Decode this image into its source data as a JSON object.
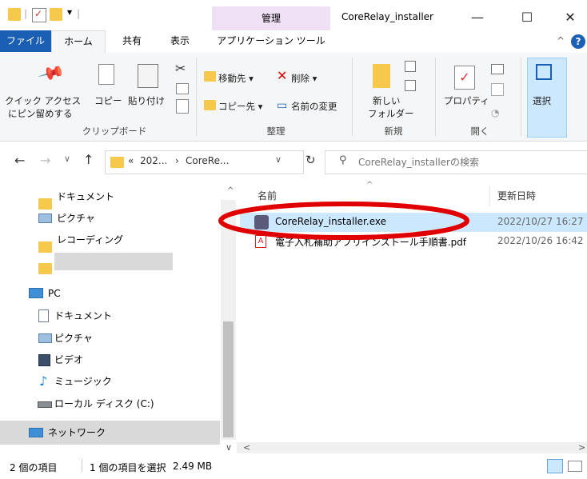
{
  "window": {
    "title": "CoreRelay_installer",
    "context_tab_group": "管理",
    "minimize": "—",
    "maximize": "☐",
    "close": "✕"
  },
  "ribbon_tabs": [
    "ファイル",
    "ホーム",
    "共有",
    "表示",
    "アプリケーション ツール"
  ],
  "ribbon": {
    "clipboard": {
      "pin_label_1": "クイック アクセス",
      "pin_label_2": "にピン留めする",
      "copy": "コピー",
      "paste": "貼り付け",
      "group": "クリップボード"
    },
    "organize": {
      "move_to": "移動先 ▾",
      "delete": "削除 ▾",
      "copy_to": "コピー先 ▾",
      "rename": "名前の変更",
      "group": "整理"
    },
    "new": {
      "new_folder_1": "新しい",
      "new_folder_2": "フォルダー",
      "group": "新規"
    },
    "open": {
      "properties": "プロパティ",
      "group": "開く"
    },
    "select": {
      "select": "選択"
    }
  },
  "address": {
    "breadcrumb_prefix": "«",
    "crumb1": "202...",
    "sep": "›",
    "crumb2": "CoreRe...",
    "search_placeholder": "CoreRelay_installerの検索"
  },
  "nav": {
    "items": [
      {
        "label": "ドキュメント",
        "icon": "folder-icon"
      },
      {
        "label": "ピクチャ",
        "icon": "pictures-icon"
      },
      {
        "label": "レコーディング",
        "icon": "folder-icon"
      },
      {
        "label": "",
        "icon": "folder-icon"
      },
      {
        "label": "PC",
        "icon": "pc-icon"
      },
      {
        "label": "ドキュメント",
        "icon": "documents-icon"
      },
      {
        "label": "ピクチャ",
        "icon": "pictures-icon"
      },
      {
        "label": "ビデオ",
        "icon": "video-icon"
      },
      {
        "label": "ミュージック",
        "icon": "music-icon"
      },
      {
        "label": "ローカル ディスク (C:)",
        "icon": "disk-icon"
      },
      {
        "label": "ネットワーク",
        "icon": "network-icon"
      }
    ]
  },
  "columns": {
    "name": "名前",
    "modified": "更新日時"
  },
  "files": [
    {
      "name": "CoreRelay_installer.exe",
      "modified": "2022/10/27 16:27",
      "icon": "installer-icon"
    },
    {
      "name": "電子入札補助アプリインストール手順書.pdf",
      "modified": "2022/10/26 16:42",
      "icon": "pdf-icon"
    }
  ],
  "status": {
    "item_count": "2 個の項目",
    "selection": "1 個の項目を選択",
    "size": "2.49 MB"
  },
  "colors": {
    "accent": "#1a5fb4",
    "selection": "#cce8ff",
    "annotation": "#e00000",
    "context_tab": "#f0e0f6"
  }
}
